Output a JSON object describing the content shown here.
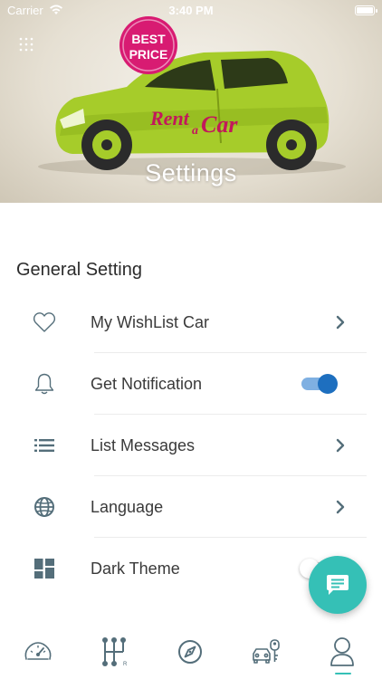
{
  "status_bar": {
    "carrier": "Carrier",
    "time": "3:40 PM"
  },
  "hero": {
    "title": "Settings",
    "badge_line1": "BEST",
    "badge_line2": "PRICE",
    "logo_line1": "Rent",
    "logo_line2": "a",
    "logo_line3": "Car",
    "menu_icon": "grid-dots-icon"
  },
  "section": {
    "title": "General Setting"
  },
  "settings": [
    {
      "label": "My WishList Car",
      "icon": "heart-icon",
      "control": "chevron"
    },
    {
      "label": "Get Notification",
      "icon": "bell-icon",
      "control": "toggle",
      "toggled": true
    },
    {
      "label": "List Messages",
      "icon": "list-icon",
      "control": "chevron"
    },
    {
      "label": "Language",
      "icon": "globe-icon",
      "control": "chevron"
    },
    {
      "label": "Dark Theme",
      "icon": "dashboard-icon",
      "control": "toggle",
      "toggled": false
    }
  ],
  "fab": {
    "icon": "chat-icon"
  },
  "tab_bar": {
    "tabs": [
      {
        "icon": "speedometer-icon",
        "active": false
      },
      {
        "icon": "gear-shift-icon",
        "active": false
      },
      {
        "icon": "compass-icon",
        "active": false
      },
      {
        "icon": "car-key-icon",
        "active": false
      },
      {
        "icon": "profile-icon",
        "active": true
      }
    ]
  },
  "colors": {
    "accent": "#1e6fbf",
    "accent_light": "#7fb0e2",
    "teal": "#35c0b6",
    "icon_gray": "#546e7a",
    "car_green": "#a6cc2a",
    "badge_pink": "#d81b72"
  }
}
